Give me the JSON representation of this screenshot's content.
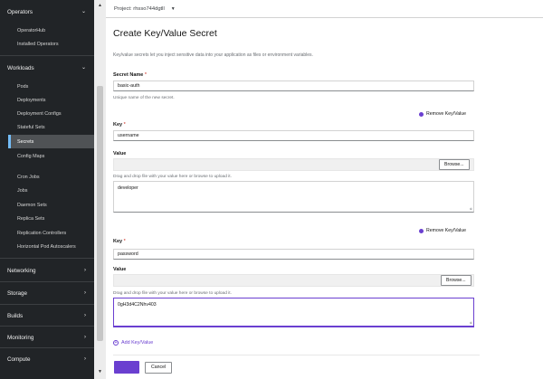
{
  "sidebar": {
    "sections": [
      {
        "label": "Operators",
        "chevron": "chevron-down-icon"
      },
      {
        "label": "Workloads",
        "chevron": "chevron-down-icon"
      },
      {
        "label": "Networking",
        "chevron": "chevron-right-icon"
      },
      {
        "label": "Storage",
        "chevron": "chevron-right-icon"
      },
      {
        "label": "Builds",
        "chevron": "chevron-right-icon"
      },
      {
        "label": "Monitoring",
        "chevron": "chevron-right-icon"
      },
      {
        "label": "Compute",
        "chevron": "chevron-right-icon"
      }
    ],
    "operators_items": [
      "OperatorHub",
      "Installed Operators"
    ],
    "workloads_items": [
      "Pods",
      "Deployments",
      "Deployment Configs",
      "Stateful Sets",
      "Secrets",
      "Config Maps",
      "Cron Jobs",
      "Jobs",
      "Daemon Sets",
      "Replica Sets",
      "Replication Controllers",
      "Horizontal Pod Autoscalers"
    ],
    "active_item": "Secrets"
  },
  "project_bar": {
    "label": "Project: rhsso744dgtll",
    "caret_icon": "caret-down-icon"
  },
  "page": {
    "title": "Create Key/Value Secret",
    "description": "Key/value secrets let you inject sensitive data into your application as files or environment variables."
  },
  "form": {
    "secret_name_label": "Secret Name",
    "required_mark": "*",
    "secret_name_value": "basic-auth",
    "secret_name_helper": "Unique name of the new secret.",
    "pairs": [
      {
        "remove_label": "Remove Key/Value",
        "key_label": "Key",
        "key_value": "username",
        "value_label": "Value",
        "browse_label": "Browse...",
        "value_helper": "Drag and drop file with your value here or browse to upload it.",
        "value_text": "developer"
      },
      {
        "remove_label": "Remove Key/Value",
        "key_label": "Key",
        "key_value": "password",
        "value_label": "Value",
        "browse_label": "Browse...",
        "value_helper": "Drag and drop file with your value here or browse to upload it.",
        "value_text": "0gH3d4C2Nhv403"
      }
    ],
    "add_label": "Add Key/Value",
    "create_label": "",
    "cancel_label": "Cancel"
  },
  "colors": {
    "sidebar_bg": "#212427",
    "active_bg": "#4f5255",
    "active_accent": "#73bcf7",
    "primary": "#6a3fd0",
    "required": "#c9190b"
  }
}
